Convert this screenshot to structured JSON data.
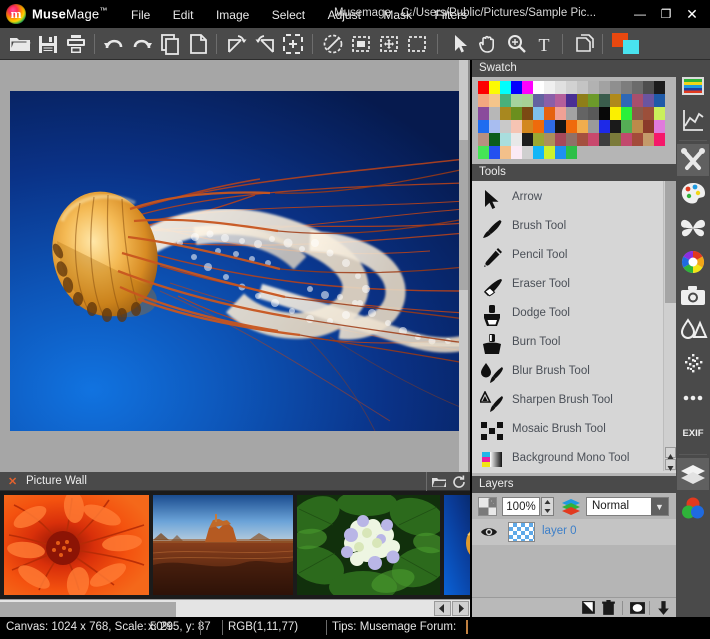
{
  "window": {
    "brand_bold": "Muse",
    "brand_light": "Mage",
    "brand_tm": "™",
    "title": "Musemage - C:/Users/Public/Pictures/Sample Pic...",
    "minimize": "—",
    "maximize": "❐",
    "close": "✕"
  },
  "menu": [
    {
      "label": "File",
      "accel": "F"
    },
    {
      "label": "Edit",
      "accel": "E"
    },
    {
      "label": "Image",
      "accel": "I"
    },
    {
      "label": "Select",
      "accel": "S"
    },
    {
      "label": "Adjust",
      "accel": "A"
    },
    {
      "label": "Mask",
      "accel": "M"
    },
    {
      "label": "Filters",
      "accel": ""
    }
  ],
  "toolbar": {
    "buttons": [
      {
        "name": "open-file",
        "label": "Open"
      },
      {
        "name": "save-file",
        "label": "Save"
      },
      {
        "name": "print",
        "label": "Print"
      },
      {
        "name": "undo",
        "label": "Undo"
      },
      {
        "name": "redo",
        "label": "Redo"
      },
      {
        "name": "copy",
        "label": "Copy"
      },
      {
        "name": "paste-new",
        "label": "New"
      },
      {
        "name": "rotate-left",
        "label": "Rotate Left"
      },
      {
        "name": "rotate-right",
        "label": "Rotate Right"
      },
      {
        "name": "fit-screen",
        "label": "Fit to Screen"
      },
      {
        "name": "deselect",
        "label": "Deselect"
      },
      {
        "name": "select-rect",
        "label": "Rectangular Select"
      },
      {
        "name": "select-move",
        "label": "Move Selection"
      },
      {
        "name": "select-crop",
        "label": "Crop Selection"
      },
      {
        "name": "arrow-tool",
        "label": "Arrow"
      },
      {
        "name": "hand-tool",
        "label": "Hand"
      },
      {
        "name": "zoom-tool",
        "label": "Zoom"
      },
      {
        "name": "text-tool",
        "label": "Text"
      },
      {
        "name": "layers-duplicate",
        "label": "Duplicate Layer"
      }
    ],
    "foreground_color": "#e8480f",
    "background_color": "#49e3ef"
  },
  "swatch": {
    "title": "Swatch",
    "colors": [
      "#fe0000",
      "#fcfa02",
      "#01fffd",
      "#0300fe",
      "#fe00fe",
      "#ffffff",
      "#efefef",
      "#e0e0e0",
      "#d2d2d2",
      "#c4c4c4",
      "#b2b2b2",
      "#a2a2a2",
      "#8f8f8f",
      "#7d7d7d",
      "#6b6b6b",
      "#4e4e4e",
      "#1c1c1c",
      "#f3a780",
      "#f4c58b",
      "#49b07b",
      "#a5d39c",
      "#a7d194",
      "#6363a0",
      "#8a5fa8",
      "#b45f9b",
      "#4a2f94",
      "#8e7e18",
      "#6c9a2a",
      "#3a5c4c",
      "#b08a1b",
      "#2f68b5",
      "#a84f6d",
      "#6b55a0",
      "#1f5aa8",
      "#8a4b9c",
      "#b7b7b7",
      "#a8881f",
      "#6b8f1e",
      "#7b4a13",
      "#7fc0ea",
      "#e5620f",
      "#f0a195",
      "#a3a3a3",
      "#646464",
      "#595959",
      "#080808",
      "#fbf000",
      "#2bf03a",
      "#8b5a4a",
      "#9c4f3a",
      "#caf05b",
      "#1f6cf0",
      "#a8bdf0",
      "#c9c9c9",
      "#f6c4b3",
      "#d3871f",
      "#ef6a0c",
      "#2f6be5",
      "#151515",
      "#ef6a0c",
      "#f0ad4e",
      "#9a9a9a",
      "#1d29e8",
      "#1a1a1a",
      "#55ad55",
      "#bd8a4a",
      "#8a3a2a",
      "#e07adc",
      "#b89080",
      "#0b5d1c",
      "#a9dede",
      "#e8e8e8",
      "#1d1d1d",
      "#9aa832",
      "#ad8f5a",
      "#a7495a",
      "#8f7168",
      "#a4503f",
      "#c9486d",
      "#3d3d3d",
      "#7b7b3a",
      "#c2496d",
      "#a34b3a",
      "#c49a6a",
      "#f5186a",
      "#45e555",
      "#2450f0",
      "#f3c08a",
      "#fbeaf5",
      "#cfcfcf",
      "#12b6f7",
      "#ccf22e",
      "#1e90f0",
      "#2cbf47"
    ]
  },
  "tools": {
    "title": "Tools",
    "items": [
      {
        "label": "Arrow",
        "icon": "arrow-icon"
      },
      {
        "label": "Brush Tool",
        "icon": "brush-icon"
      },
      {
        "label": "Pencil Tool",
        "icon": "pencil-icon"
      },
      {
        "label": "Eraser Tool",
        "icon": "eraser-icon"
      },
      {
        "label": "Dodge Tool",
        "icon": "dodge-icon"
      },
      {
        "label": "Burn Tool",
        "icon": "burn-icon"
      },
      {
        "label": "Blur Brush Tool",
        "icon": "blur-brush-icon"
      },
      {
        "label": "Sharpen Brush Tool",
        "icon": "sharpen-brush-icon"
      },
      {
        "label": "Mosaic Brush Tool",
        "icon": "mosaic-brush-icon"
      },
      {
        "label": "Background Mono Tool",
        "icon": "background-mono-icon"
      }
    ]
  },
  "layers": {
    "title": "Layers",
    "opacity": "100%",
    "blend_mode": "Normal",
    "blend_options": [
      "Normal"
    ],
    "rows": [
      {
        "name": "layer 0",
        "visible": true
      }
    ],
    "buttons": [
      {
        "name": "new-layer-button",
        "label": "New Layer"
      },
      {
        "name": "delete-layer-button",
        "label": "Delete Layer"
      },
      {
        "name": "layer-mask-button",
        "label": "Layer Mask"
      },
      {
        "name": "move-layer-down-button",
        "label": "Move Down"
      },
      {
        "name": "move-layer-up-button",
        "label": "Move Up"
      }
    ]
  },
  "picture_wall": {
    "title": "Picture Wall",
    "close_glyph": "✕",
    "tools": [
      {
        "name": "open-folder-icon",
        "label": "Open Folder"
      },
      {
        "name": "refresh-icon",
        "label": "Refresh"
      }
    ],
    "thumbnails": [
      {
        "name": "chrysanthemum-thumbnail"
      },
      {
        "name": "desert-thumbnail"
      },
      {
        "name": "hydrangeas-thumbnail"
      },
      {
        "name": "jellyfish-thumbnail"
      }
    ]
  },
  "rail": {
    "buttons": [
      {
        "name": "histogram-palette-icon",
        "label": "Color Bars"
      },
      {
        "name": "curve-icon",
        "label": "Curves"
      },
      {
        "name": "tools-icon",
        "label": "Tools",
        "active": true
      },
      {
        "name": "palette-icon",
        "label": "Palette"
      },
      {
        "name": "butterfly-icon",
        "label": "Effects"
      },
      {
        "name": "color-wheel-icon",
        "label": "Color Wheel"
      },
      {
        "name": "camera-icon",
        "label": "Camera"
      },
      {
        "name": "water-drop-icon",
        "label": "Blur / Sharpen"
      },
      {
        "name": "noise-icon",
        "label": "Noise"
      },
      {
        "name": "more-icon",
        "label": "More"
      },
      {
        "name": "exif-icon",
        "label": "EXIF"
      },
      {
        "name": "layers-icon",
        "label": "Layers",
        "active": true
      },
      {
        "name": "rgb-channels-icon",
        "label": "Channels"
      }
    ],
    "exif_label": "EXIF"
  },
  "status": {
    "canvas": "Canvas: 1024 x 768, Scale: 50%",
    "cursor": "x: 295, y: 87",
    "rgb": "RGB(1,11,77)",
    "tips": "Tips: Musemage Forum:"
  },
  "canvas": {
    "image_name": "jellyfish-image"
  }
}
